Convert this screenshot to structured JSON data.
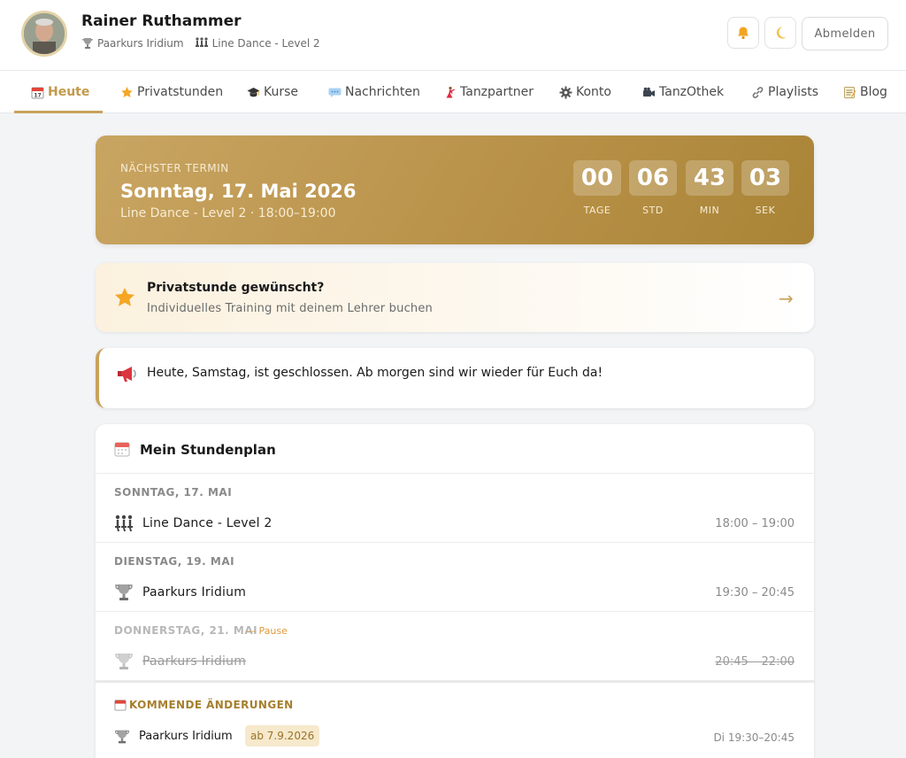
{
  "user": {
    "name": "Rainer Ruthammer",
    "course1": "Paarkurs Iridium",
    "course2": "Line Dance - Level 2"
  },
  "header": {
    "logout_label": "Abmelden",
    "icons": [
      "bell-icon",
      "moon-icon"
    ]
  },
  "nav": {
    "items": [
      {
        "label": "Heute",
        "icon": "calendar-icon",
        "active": true
      },
      {
        "label": "Privatstunden",
        "icon": "star-icon"
      },
      {
        "label": "Kurse",
        "icon": "graduation-cap-icon"
      },
      {
        "label": "Nachrichten",
        "icon": "speech-bubble-icon"
      },
      {
        "label": "Tanzpartner",
        "icon": "dancer-icon"
      },
      {
        "label": "Konto",
        "icon": "gear-icon"
      },
      {
        "label": "TanzOthek",
        "icon": "video-camera-icon"
      },
      {
        "label": "Playlists",
        "icon": "link-icon"
      },
      {
        "label": "Blog",
        "icon": "memo-icon"
      }
    ]
  },
  "next_event": {
    "kicker": "NÄCHSTER TERMIN",
    "date": "Sonntag, 17. Mai 2026",
    "detail": "Line Dance - Level 2 · 18:00–19:00",
    "countdown": [
      {
        "value": "00",
        "label": "TAGE"
      },
      {
        "value": "06",
        "label": "STD"
      },
      {
        "value": "43",
        "label": "MIN"
      },
      {
        "value": "03",
        "label": "SEK"
      }
    ]
  },
  "promo": {
    "title": "Privatstunde gewünscht?",
    "subtitle": "Individuelles Training mit deinem Lehrer buchen",
    "arrow": "→"
  },
  "notice": {
    "text": "Heute, Samstag, ist geschlossen. Ab morgen sind wir wieder für Euch da!"
  },
  "schedule": {
    "title": "Mein Stundenplan",
    "days": [
      {
        "day": "SONNTAG, 17. MAI",
        "course": "Line Dance - Level 2",
        "time": "18:00 – 19:00",
        "icon": "line-dance-icon"
      },
      {
        "day": "DIENSTAG, 19. MAI",
        "course": "Paarkurs Iridium",
        "time": "19:30 – 20:45",
        "icon": "trophy-icon"
      },
      {
        "day": "DONNERSTAG, 21. MAI",
        "pause": "— Pause",
        "course": "Paarkurs Iridium",
        "time": "20:45 – 22:00",
        "icon": "trophy-icon",
        "cancelled": true
      }
    ],
    "changes": {
      "title": "KOMMENDE ÄNDERUNGEN",
      "items": [
        {
          "course": "Paarkurs Iridium",
          "badge": "ab 7.9.2026",
          "time": "Di 19:30–20:45",
          "icon": "trophy-icon"
        }
      ]
    }
  },
  "colors": {
    "accent": "#c8a35b",
    "hero_start": "#c8a562",
    "hero_end": "#a98436",
    "pause": "#e09a3c"
  }
}
